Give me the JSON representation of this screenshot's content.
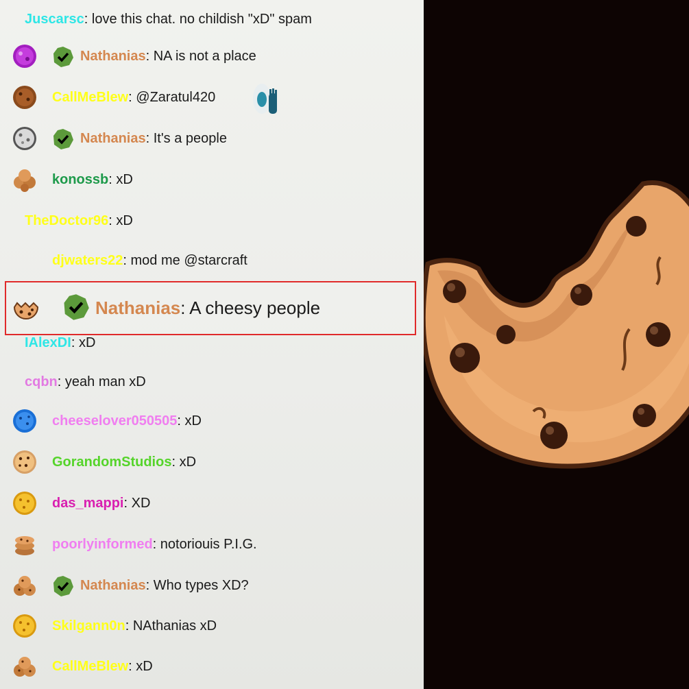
{
  "chat": {
    "messages": [
      {
        "user": "Juscarsc",
        "color": "#2ee6e6",
        "text": "love this chat. no childish \"xD\" spam",
        "avatar": "none",
        "mod": false
      },
      {
        "user": "Nathanias",
        "color": "#d4874f",
        "text": "NA is not a place",
        "avatar": "purple-cookie",
        "mod": true
      },
      {
        "user": "CallMeBlew",
        "color": "#ffff1a",
        "text": "@Zaratul420",
        "avatar": "chocolate-cookie",
        "mod": false,
        "emote": "zaratul-emote"
      },
      {
        "user": "Nathanias",
        "color": "#d4874f",
        "text": "It's a people",
        "avatar": "silver-cookie",
        "mod": true
      },
      {
        "user": "konossb",
        "color": "#1d9a4a",
        "text": "xD",
        "avatar": "stack-cookie",
        "mod": false
      },
      {
        "user": "TheDoctor96",
        "color": "#ffff1a",
        "text": "xD",
        "avatar": "none",
        "mod": false
      },
      {
        "user": "djwaters22",
        "color": "#ffff1a",
        "text": "mod me @starcraft",
        "avatar": "none",
        "mod": false
      },
      {
        "user": "IAlexDI",
        "color": "#2ee6e6",
        "text": "xD",
        "avatar": "none",
        "mod": false
      },
      {
        "user": "cqbn",
        "color": "#e27ae2",
        "text": "yeah man xD",
        "avatar": "none",
        "mod": false
      },
      {
        "user": "cheeselover050505",
        "color": "#f07ef0",
        "text": "xD",
        "avatar": "blue-cookie",
        "mod": false
      },
      {
        "user": "GorandomStudios",
        "color": "#55d42a",
        "text": "xD",
        "avatar": "chip-cookie",
        "mod": false
      },
      {
        "user": "das_mappi",
        "color": "#d91fb0",
        "text": "XD",
        "avatar": "gold-cookie",
        "mod": false
      },
      {
        "user": "poorlyinformed",
        "color": "#f07ef0",
        "text": "notoriouis P.I.G.",
        "avatar": "stack-cookie",
        "mod": false
      },
      {
        "user": "Nathanias",
        "color": "#d4874f",
        "text": "Who types XD?",
        "avatar": "pile-cookie",
        "mod": true
      },
      {
        "user": "Skilgann0n",
        "color": "#ffff1a",
        "text": "NAthanias xD",
        "avatar": "gold-cookie",
        "mod": false
      },
      {
        "user": "CallMeBlew",
        "color": "#ffff1a",
        "text": "xD",
        "avatar": "pile-cookie",
        "mod": false
      }
    ],
    "highlighted": {
      "user": "Nathanias",
      "color": "#d4874f",
      "text": "A cheesy people",
      "avatar": "bitten-cookie",
      "mod": true
    },
    "separator": ": "
  },
  "art": {
    "icon": "bitten-cookie-art",
    "bg": "#0d0403"
  }
}
